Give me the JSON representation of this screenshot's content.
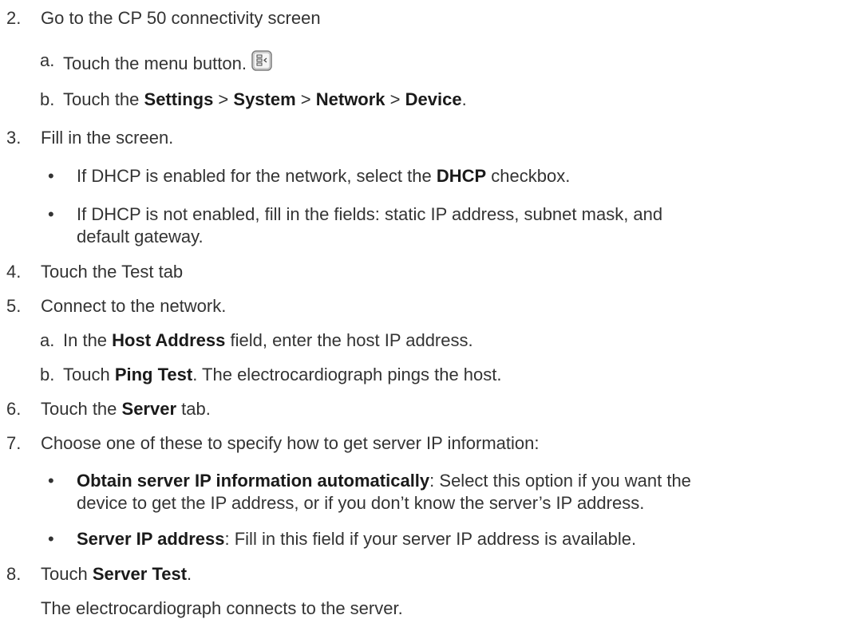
{
  "steps": {
    "s2": {
      "number": "2.",
      "text": "Go to the CP 50 connectivity screen",
      "a": {
        "marker": "a.",
        "text": "Touch the menu button.",
        "icon": "menu-button-icon"
      },
      "b": {
        "marker": "b.",
        "pre": "Touch the ",
        "settings": "Settings",
        "sep1": " > ",
        "system": "System",
        "sep2": " > ",
        "network": "Network",
        "sep3": " > ",
        "device": "Device",
        "post": "."
      }
    },
    "s3": {
      "number": "3.",
      "text": "Fill in the screen.",
      "bullet1": {
        "marker": "•",
        "pre": "If DHCP is enabled for the network, select the ",
        "bold": "DHCP",
        "post": " checkbox."
      },
      "bullet2": {
        "marker": "•",
        "line1": "If DHCP is not enabled, fill in the fields: static IP address, subnet mask, and",
        "line2": "default gateway."
      }
    },
    "s4": {
      "number": "4.",
      "text": "Touch the Test tab"
    },
    "s5": {
      "number": "5.",
      "text": "Connect to the network.",
      "a": {
        "marker": "a.",
        "pre": "In the ",
        "bold": "Host Address",
        "post": " field, enter the host IP address."
      },
      "b": {
        "marker": "b.",
        "pre": "Touch ",
        "bold": "Ping Test",
        "post": ". The electrocardiograph pings the host."
      }
    },
    "s6": {
      "number": "6.",
      "pre": "Touch the ",
      "bold": "Server",
      "post": " tab."
    },
    "s7": {
      "number": "7.",
      "text": "Choose one of these to specify how to get server IP information:",
      "bullet1": {
        "marker": "•",
        "bold": "Obtain server IP information automatically",
        "post": ": Select this option if you want the",
        "line2": "device to get the IP address, or if you don’t know the server’s IP address."
      },
      "bullet2": {
        "marker": "•",
        "bold": "Server IP address",
        "post": ": Fill in this field if your server IP address is available."
      }
    },
    "s8": {
      "number": "8.",
      "pre": "Touch ",
      "bold": "Server Test",
      "post": ".",
      "result": "The electrocardiograph connects to the server."
    }
  }
}
